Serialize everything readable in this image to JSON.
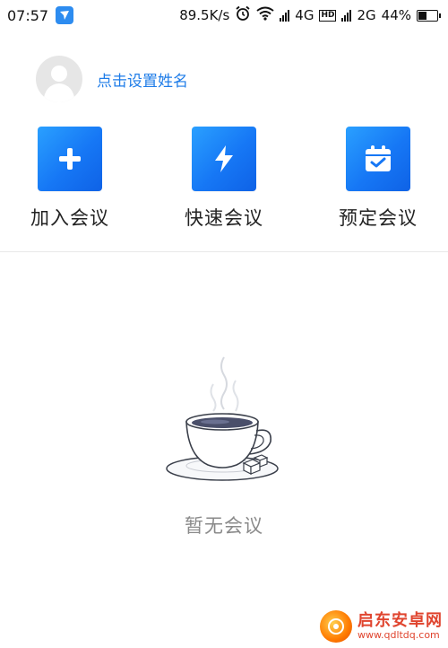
{
  "status_bar": {
    "time": "07:57",
    "speed": "89.5K/s",
    "network_1": "4G",
    "hd": "HD",
    "network_2": "2G",
    "battery": "44%",
    "battery_level": 0.44
  },
  "profile": {
    "set_name_label": "点击设置姓名"
  },
  "actions": [
    {
      "label": "加入会议",
      "icon": "plus-icon"
    },
    {
      "label": "快速会议",
      "icon": "lightning-icon"
    },
    {
      "label": "预定会议",
      "icon": "calendar-check-icon"
    }
  ],
  "empty_state": {
    "text": "暂无会议",
    "icon": "coffee-cup-icon"
  },
  "watermark": {
    "title": "启东安卓网",
    "url": "www.qdltdq.com"
  },
  "colors": {
    "accent": "#1e7ce8",
    "tile_gradient_start": "#2aa0ff",
    "tile_gradient_end": "#0f62e6"
  }
}
